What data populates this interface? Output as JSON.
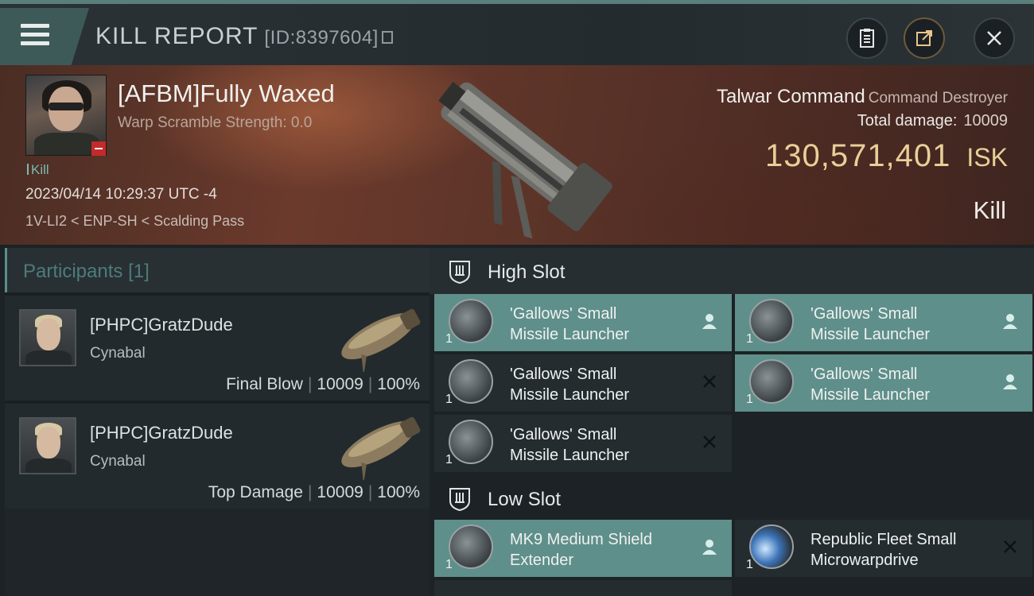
{
  "header": {
    "title": "KILL REPORT",
    "id_label": "[ID:8397604]"
  },
  "victim": {
    "name": "[AFBM]Fully Waxed",
    "warp_scramble": "Warp Scramble Strength: 0.0",
    "kills": "Kill",
    "timestamp": "2023/04/14 10:29:37 UTC -4",
    "location": "1V-LI2 < ENP-SH < Scalding Pass"
  },
  "ship": {
    "name": "Talwar Command",
    "class": "Command Destroyer",
    "total_damage_label": "Total damage:",
    "total_damage": "10009",
    "isk_value": "130,571,401",
    "isk_unit": "ISK",
    "result": "Kill"
  },
  "participants": {
    "title": "Participants",
    "count": "[1]",
    "list": [
      {
        "name": "[PHPC]GratzDude",
        "ship": "Cynabal",
        "role": "Final Blow",
        "damage": "10009",
        "percent": "100%"
      },
      {
        "name": "[PHPC]GratzDude",
        "ship": "Cynabal",
        "role": "Top Damage",
        "damage": "10009",
        "percent": "100%"
      }
    ]
  },
  "slots": {
    "high": {
      "label": "High Slot",
      "modules": [
        {
          "qty": "1",
          "line1": "'Gallows' Small",
          "line2": "Missile Launcher",
          "state": "person-icon",
          "active": true
        },
        {
          "qty": "1",
          "line1": "'Gallows' Small",
          "line2": "Missile Launcher",
          "state": "person-icon",
          "active": true
        },
        {
          "qty": "1",
          "line1": "'Gallows' Small",
          "line2": "Missile Launcher",
          "state": "destroyed-x-icon",
          "active": false
        },
        {
          "qty": "1",
          "line1": "'Gallows' Small",
          "line2": "Missile Launcher",
          "state": "person-icon",
          "active": true
        },
        {
          "qty": "1",
          "line1": "'Gallows' Small",
          "line2": "Missile Launcher",
          "state": "destroyed-x-icon",
          "active": false
        }
      ]
    },
    "low": {
      "label": "Low Slot",
      "modules": [
        {
          "qty": "1",
          "line1": "MK9 Medium Shield",
          "line2": "Extender",
          "state": "person-icon",
          "active": true
        },
        {
          "qty": "1",
          "line1": "Republic Fleet Small",
          "line2": "Microwarpdrive",
          "state": "destroyed-x-icon",
          "active": false
        }
      ]
    }
  },
  "colors": {
    "accent": "#5f8f8a",
    "isk": "#e9cf98",
    "destroy_badge": "#c42a2a"
  }
}
